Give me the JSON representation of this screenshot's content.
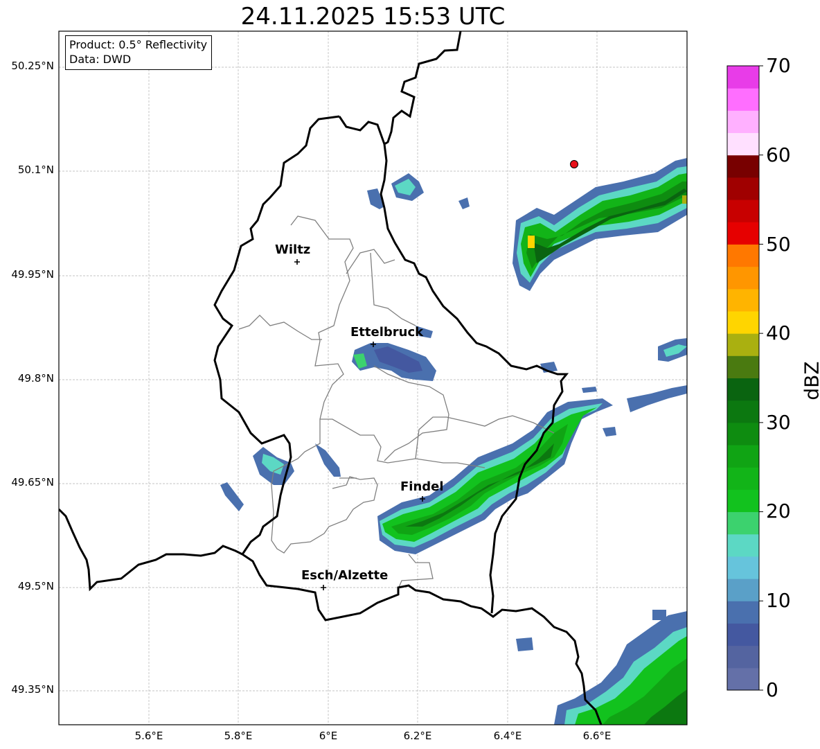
{
  "title": "24.11.2025 15:53 UTC",
  "info": {
    "product": "Product: 0.5° Reflectivity",
    "data": "Data: DWD"
  },
  "map": {
    "lon_range": [
      5.4,
      6.8
    ],
    "lat_range": [
      49.3,
      50.3
    ],
    "lat_ticks": [
      "50.25°N",
      "50.1°N",
      "49.95°N",
      "49.8°N",
      "49.65°N",
      "49.5°N",
      "49.35°N"
    ],
    "lon_ticks": [
      "5.6°E",
      "5.8°E",
      "6°E",
      "6.2°E",
      "6.4°E",
      "6.6°E"
    ],
    "gridlines": true,
    "cities": [
      {
        "name": "Wiltz",
        "lon": 5.93,
        "lat": 49.97
      },
      {
        "name": "Ettelbruck",
        "lon": 6.1,
        "lat": 49.85
      },
      {
        "name": "Findel",
        "lon": 6.21,
        "lat": 49.63
      },
      {
        "name": "Esch/Alzette",
        "lon": 5.99,
        "lat": 49.5
      }
    ],
    "radar_site": {
      "lon": 6.55,
      "lat": 50.11,
      "color": "#e8101a"
    }
  },
  "colorbar": {
    "label": "dBZ",
    "ticks": [
      "0",
      "10",
      "20",
      "30",
      "40",
      "50",
      "60",
      "70"
    ],
    "colors": [
      "#6470a8",
      "#5464a0",
      "#4458a0",
      "#4a70ae",
      "#5aa0c8",
      "#66c4dc",
      "#5cd8c4",
      "#3cd26e",
      "#12c21e",
      "#12b418",
      "#10a414",
      "#0e8c10",
      "#0c7810",
      "#0a6410",
      "#4a7a10",
      "#aab010",
      "#ffd500",
      "#ffb400",
      "#ff9600",
      "#ff7800",
      "#e60000",
      "#c80000",
      "#a00000",
      "#780000",
      "#ffe0ff",
      "#ffb0ff",
      "#ff6eff",
      "#e83ce8"
    ]
  }
}
